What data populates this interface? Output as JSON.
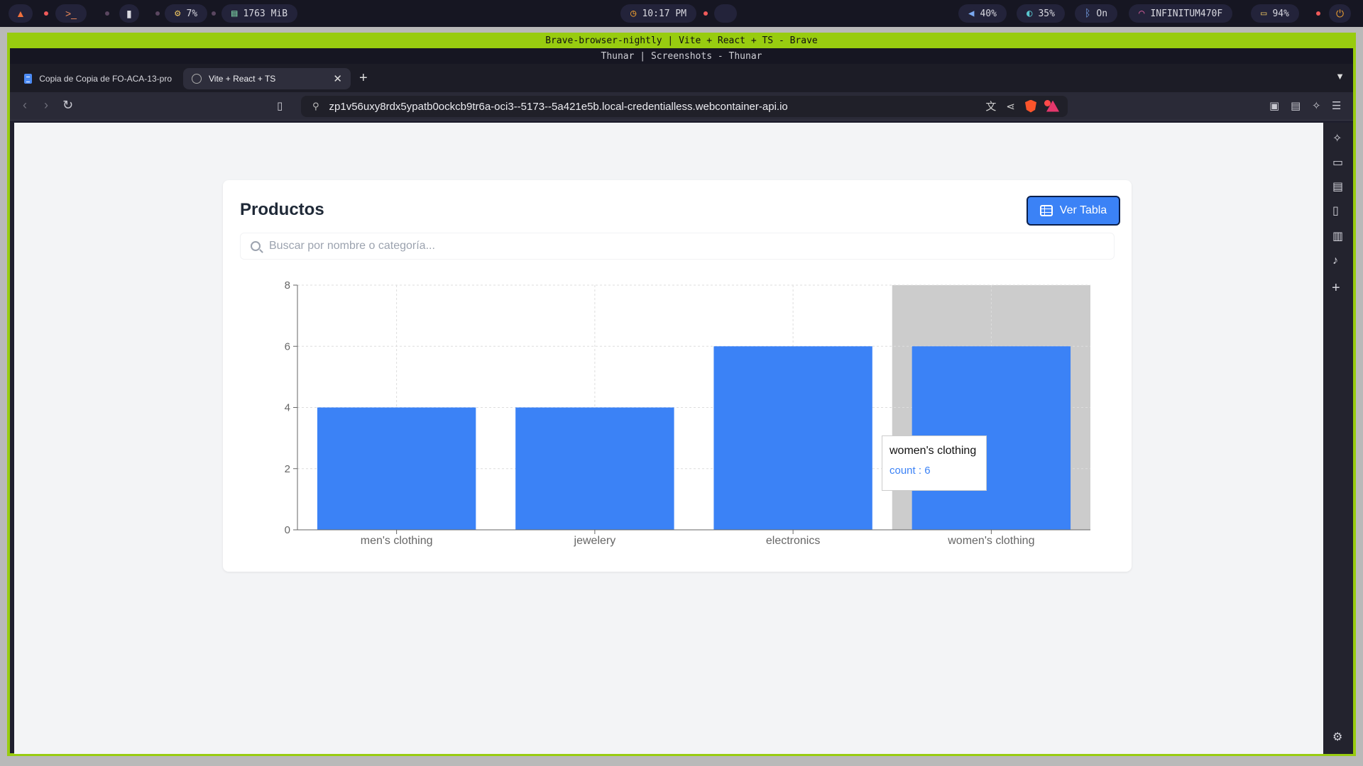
{
  "topbar": {
    "cpu": "7%",
    "memory": "1763 MiB",
    "clock": "10:17 PM",
    "volume": "40%",
    "brightness": "35%",
    "bluetooth": "On",
    "wifi": "INFINITUM470F",
    "battery": "94%"
  },
  "window": {
    "title": "Brave-browser-nightly | Vite + React + TS - Brave",
    "subtitle": "Thunar | Screenshots - Thunar"
  },
  "tabs": [
    {
      "label": "Copia de Copia de FO-ACA-13-pro"
    },
    {
      "label": "Vite + React + TS"
    }
  ],
  "address": {
    "url": "zp1v56uxy8rdx5ypatb0ockcb9tr6a-oci3--5173--5a421e5b.local-credentialless.webcontainer-api.io"
  },
  "page": {
    "title": "Productos",
    "view_button": "Ver Tabla",
    "search_placeholder": "Buscar por nombre o categoría..."
  },
  "tooltip": {
    "title": "women's clothing",
    "value": "count : 6"
  },
  "chart_data": {
    "type": "bar",
    "categories": [
      "men's clothing",
      "jewelery",
      "electronics",
      "women's clothing"
    ],
    "values": [
      4,
      4,
      6,
      6
    ],
    "ylim": [
      0,
      8
    ],
    "yticks": [
      0,
      2,
      4,
      6,
      8
    ],
    "grid": true,
    "bar_color": "#3b82f6",
    "highlighted_category": "women's clothing"
  }
}
